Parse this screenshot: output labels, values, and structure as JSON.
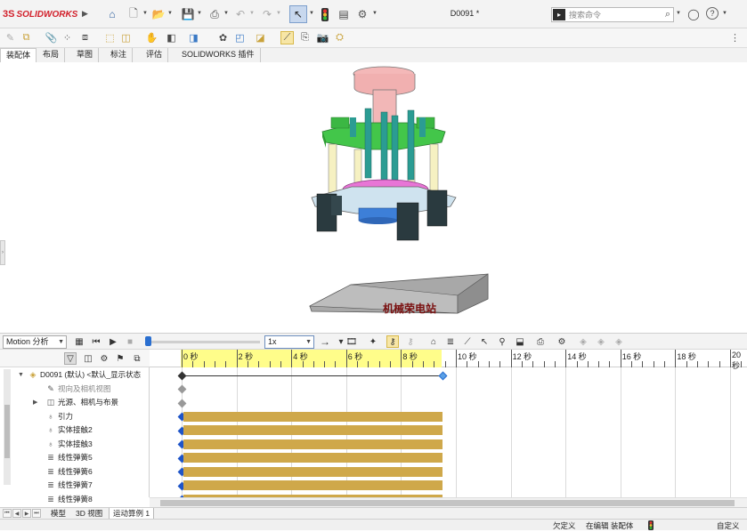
{
  "app": {
    "logo_prefix": "3S",
    "logo_text": "SOLIDWORKS",
    "doc_title": "D0091 *"
  },
  "search": {
    "placeholder": "搜索命令"
  },
  "tabs": [
    {
      "label": "装配体",
      "active": true
    },
    {
      "label": "布局",
      "active": false
    },
    {
      "label": "草图",
      "active": false
    },
    {
      "label": "标注",
      "active": false
    },
    {
      "label": "评估",
      "active": false
    },
    {
      "label": "SOLIDWORKS 插件",
      "active": false
    }
  ],
  "motion": {
    "study_type": "Motion 分析",
    "playback_speed": "1x",
    "time_slider_fraction": 0.0
  },
  "tree": {
    "items": [
      {
        "label": "D0091 (默认) <默认_显示状态",
        "icon": "assembly-icon",
        "muted": false
      },
      {
        "label": "视向及相机视图",
        "icon": "camera-views-icon",
        "muted": true
      },
      {
        "label": "光源、相机与布景",
        "icon": "lights-icon",
        "muted": false
      },
      {
        "label": "引力",
        "icon": "gravity-icon",
        "muted": false
      },
      {
        "label": "实体接触2",
        "icon": "contact-icon",
        "muted": false
      },
      {
        "label": "实体接触3",
        "icon": "contact-icon",
        "muted": false
      },
      {
        "label": "线性弹簧5",
        "icon": "spring-icon",
        "muted": false
      },
      {
        "label": "线性弹簧6",
        "icon": "spring-icon",
        "muted": false
      },
      {
        "label": "线性弹簧7",
        "icon": "spring-icon",
        "muted": false
      },
      {
        "label": "线性弹簧8",
        "icon": "spring-icon",
        "muted": false
      }
    ]
  },
  "timeline": {
    "tick_labels": [
      "0",
      "2",
      "4",
      "6",
      "8",
      "10",
      "12",
      "14",
      "16",
      "18",
      "20"
    ],
    "tick_seconds": [
      0,
      2,
      4,
      6,
      8,
      10,
      12,
      14,
      16,
      18,
      20
    ],
    "end_time": 9.5
  },
  "bottom_tabs": [
    {
      "label": "模型",
      "active": false
    },
    {
      "label": "3D 视图",
      "active": false
    },
    {
      "label": "运动算例 1",
      "active": true
    }
  ],
  "status": {
    "under_defined": "欠定义",
    "editing": "在编辑 装配体",
    "custom": "自定义"
  },
  "watermark": "机械荣电站",
  "colors": {
    "accent": "#2a6fd0",
    "timeline_bar": "#cfa84a",
    "ruler_yellow": "#fffd8a"
  }
}
